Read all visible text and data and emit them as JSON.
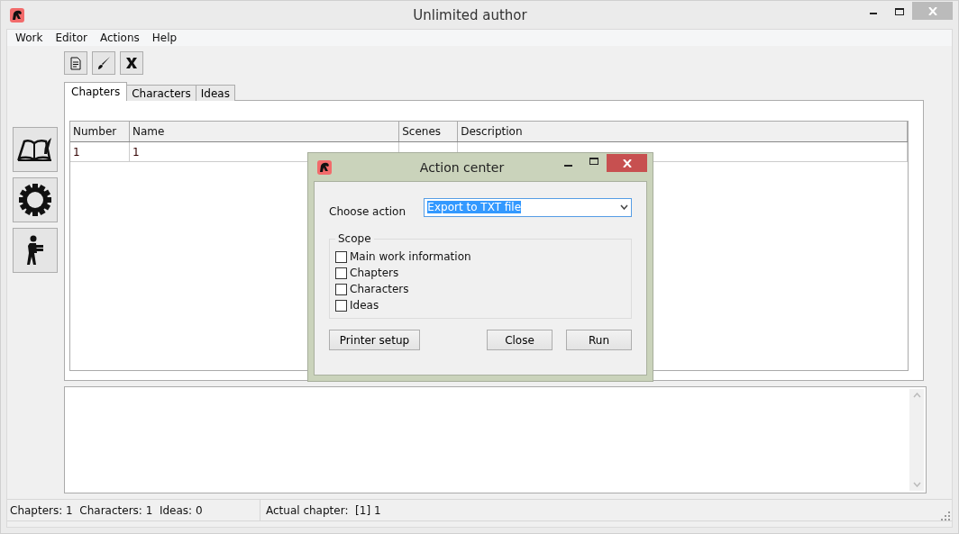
{
  "window": {
    "title": "Unlimited author"
  },
  "menu": [
    "Work",
    "Editor",
    "Actions",
    "Help"
  ],
  "tabs": [
    {
      "label": "Chapters",
      "selected": true
    },
    {
      "label": "Characters",
      "selected": false
    },
    {
      "label": "Ideas",
      "selected": false
    }
  ],
  "table": {
    "columns": [
      "Number",
      "Name",
      "Scenes",
      "Description"
    ],
    "rows": [
      [
        "1",
        "1"
      ]
    ]
  },
  "status_bar": {
    "counts": "Chapters: 1  Characters: 1  Ideas: 0",
    "actual_chapter": "Actual chapter:  [1] 1"
  },
  "dialog": {
    "title": "Action center",
    "choose_label": "Choose action",
    "action_value": "Export to TXT file",
    "scope_title": "Scope",
    "scope": [
      {
        "label": "Main work information",
        "checked": false
      },
      {
        "label": "Chapters",
        "checked": false
      },
      {
        "label": "Characters",
        "checked": false
      },
      {
        "label": "Ideas",
        "checked": false
      }
    ],
    "buttons": [
      "Printer setup",
      "Close",
      "Run"
    ]
  }
}
